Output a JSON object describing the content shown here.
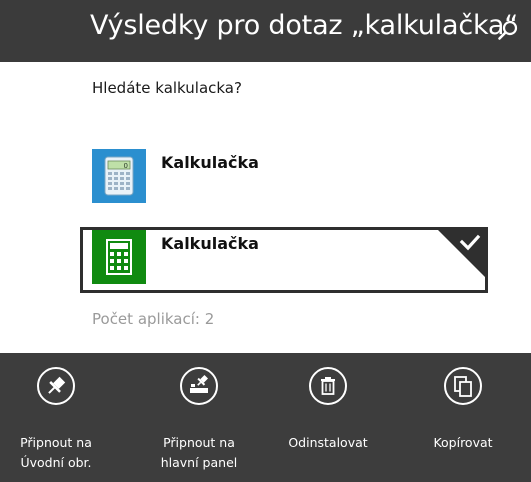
{
  "header": {
    "title": "Výsledky pro dotaz „kalkulačka“",
    "search_icon": "search-icon",
    "background": "#3b3b3b"
  },
  "suggestion": "Hledáte kalkulacka?",
  "results": [
    {
      "name": "Kalkulačka",
      "icon": "calculator-desktop-icon",
      "selected": false,
      "icon_color": "#2b8fcf"
    },
    {
      "name": "Kalkulačka",
      "icon": "calculator-modern-icon",
      "selected": true,
      "icon_color": "#108a10"
    }
  ],
  "count_text": "Počet aplikací: 2",
  "appbar": {
    "background": "#3d3d3d",
    "commands": [
      {
        "label": "Připnout na\nÚvodní obr.",
        "icon": "pin-icon"
      },
      {
        "label": "Připnout na\nhlavní panel",
        "icon": "pin-taskbar-icon"
      },
      {
        "label": "Odinstalovat",
        "icon": "trash-icon"
      },
      {
        "label": "Kopírovat",
        "icon": "copy-icon"
      }
    ]
  }
}
